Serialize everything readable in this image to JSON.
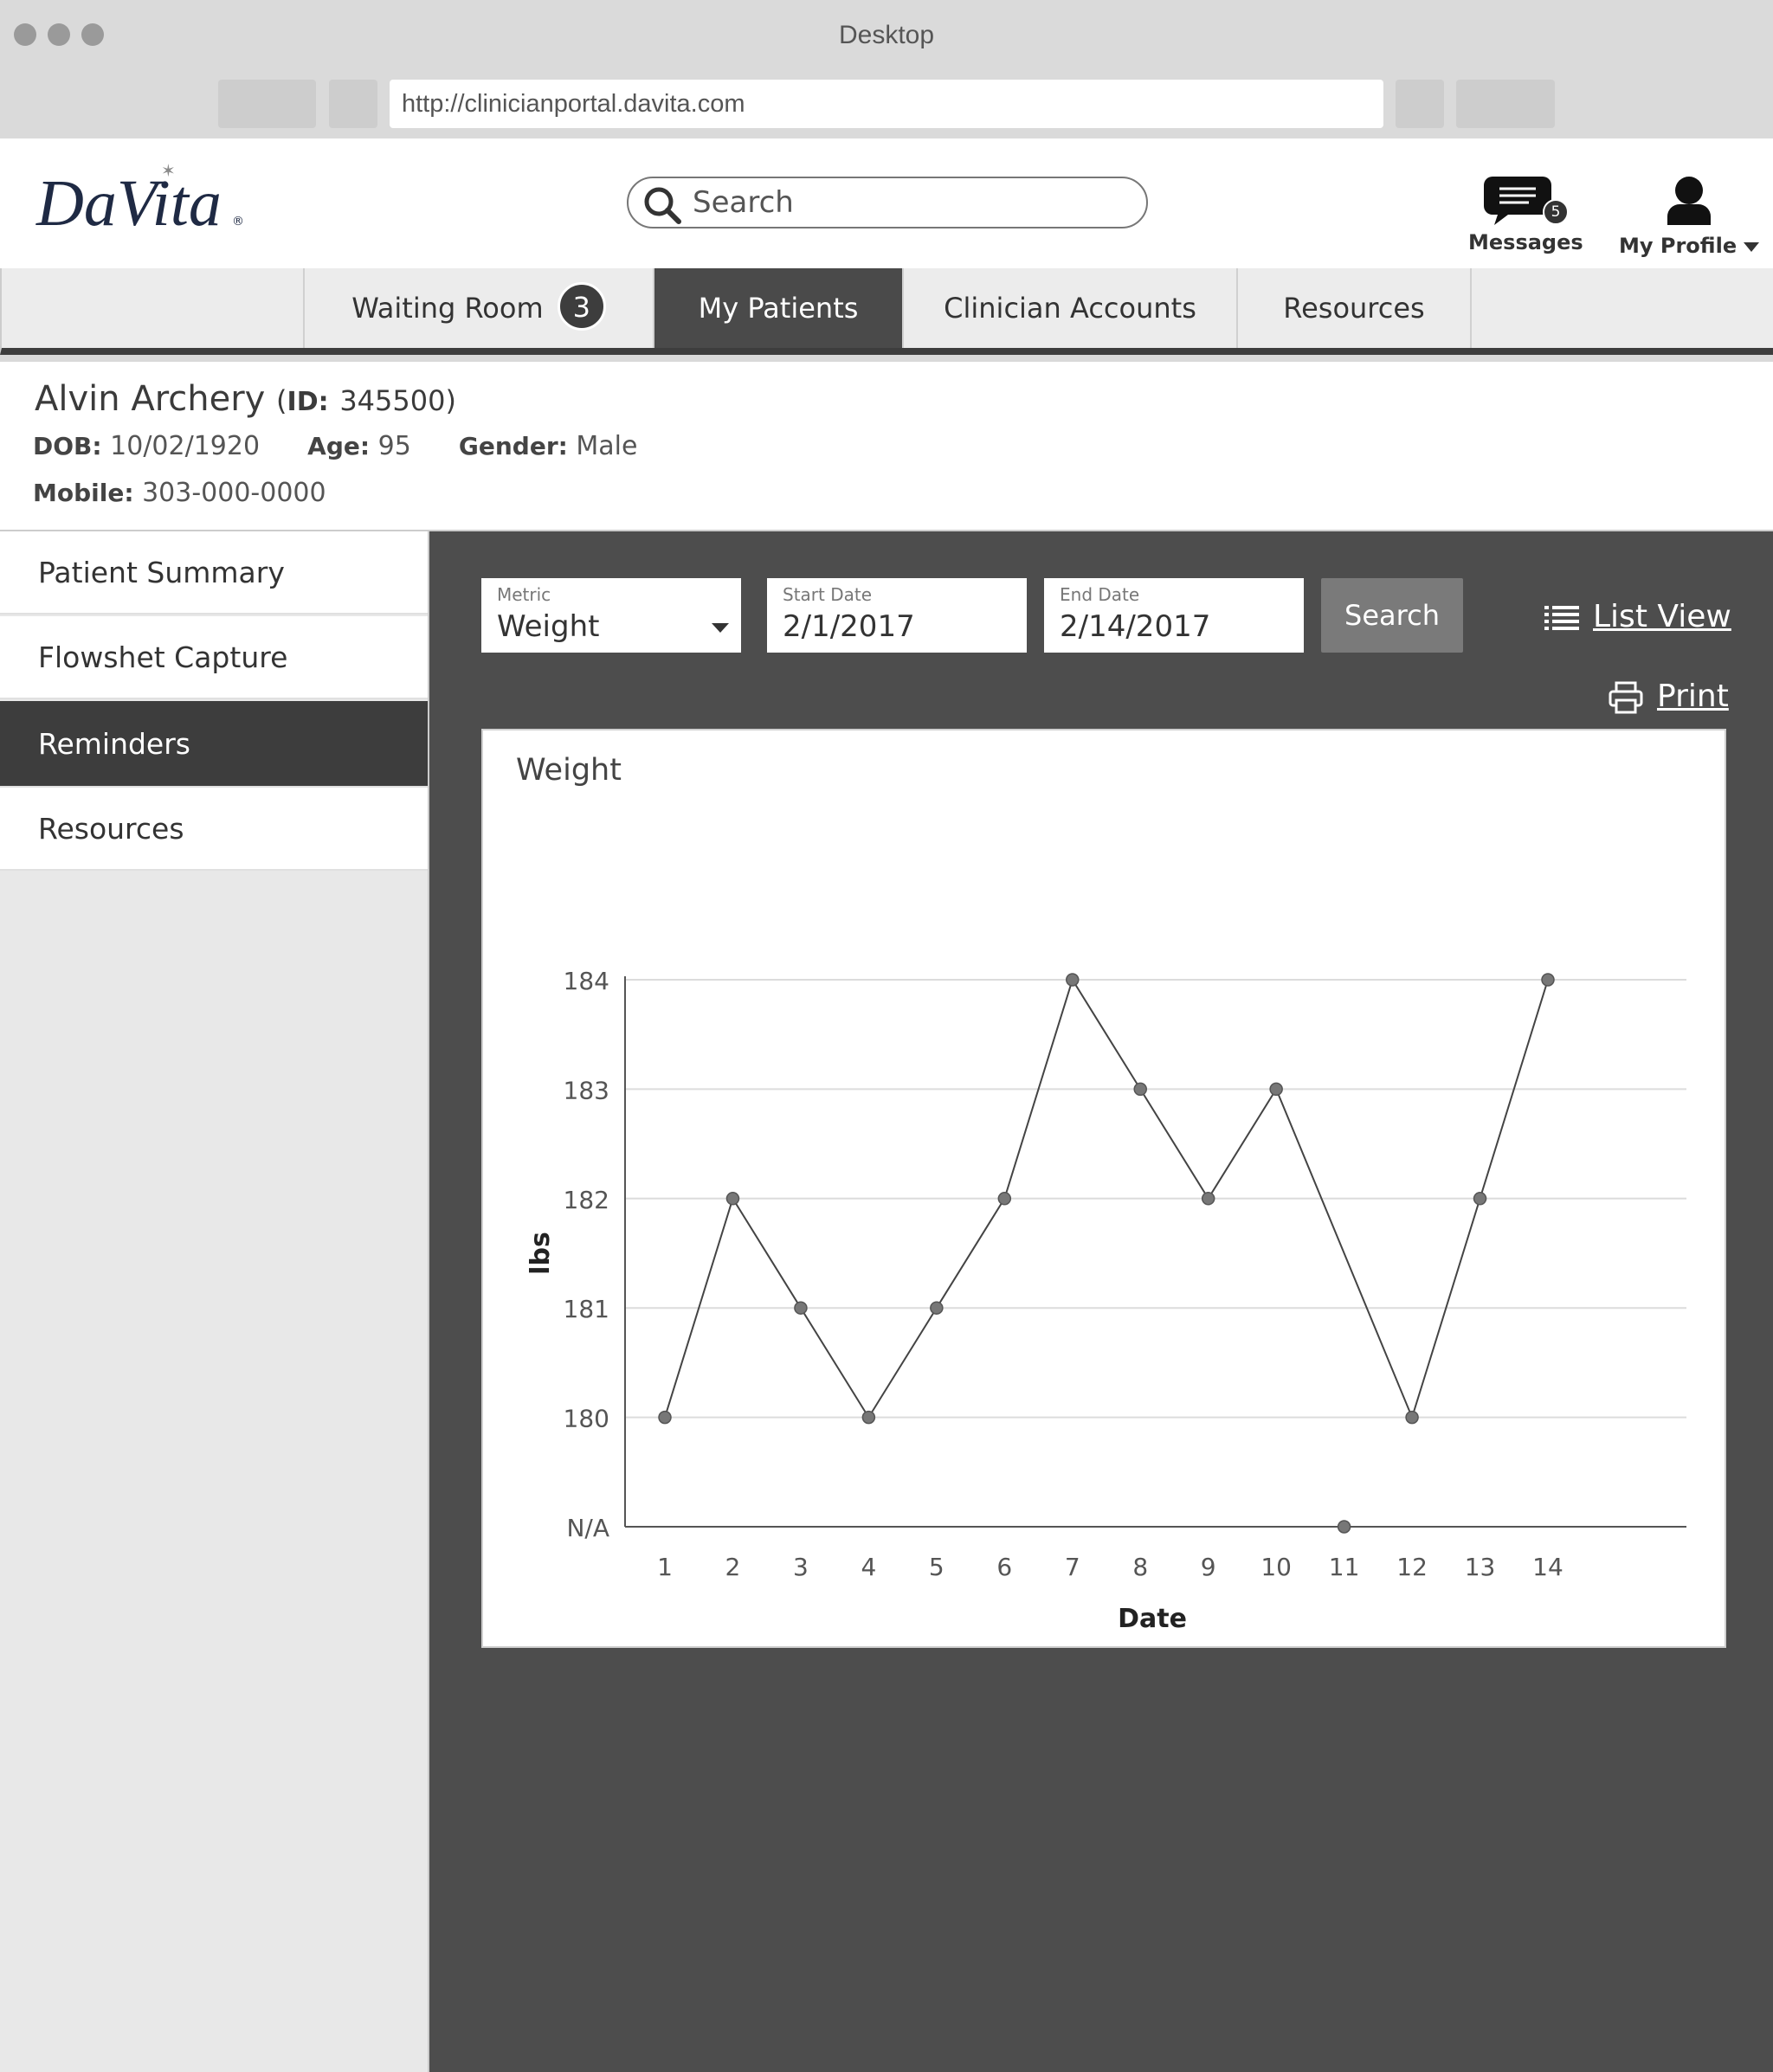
{
  "window": {
    "title": "Desktop",
    "url": "http://clinicianportal.davita.com"
  },
  "brand": {
    "logo_text": "DaVita",
    "primary_color": "#1f2a44"
  },
  "header": {
    "search_placeholder": "Search",
    "messages": {
      "label": "Messages",
      "count": "5",
      "icon": "chat-bubble-icon"
    },
    "profile": {
      "label": "My Profile",
      "icon": "user-icon"
    }
  },
  "nav": {
    "tabs": [
      {
        "label": "Waiting Room",
        "badge": "3"
      },
      {
        "label": "My Patients",
        "active": true
      },
      {
        "label": "Clinician Accounts"
      },
      {
        "label": "Resources"
      }
    ]
  },
  "patient": {
    "name": "Alvin Archery",
    "id_label": "ID:",
    "id_value": "345500",
    "dob_label": "DOB:",
    "dob": "10/02/1920",
    "age_label": "Age:",
    "age": "95",
    "gender_label": "Gender:",
    "gender": "Male",
    "mobile_label": "Mobile:",
    "mobile": "303-000-0000"
  },
  "sidebar": {
    "items": [
      {
        "label": "Patient Summary"
      },
      {
        "label": "Flowshet Capture"
      },
      {
        "label": "Reminders",
        "active": true
      },
      {
        "label": "Resources"
      }
    ]
  },
  "filters": {
    "metric_label": "Metric",
    "metric_value": "Weight",
    "start_label": "Start Date",
    "start_value": "2/1/2017",
    "end_label": "End Date",
    "end_value": "2/14/2017",
    "search_button": "Search",
    "list_view": "List View",
    "print": "Print"
  },
  "chart_data": {
    "type": "line",
    "title": "Weight",
    "xlabel": "Date",
    "ylabel": "lbs",
    "x": [
      1,
      2,
      3,
      4,
      5,
      6,
      7,
      8,
      9,
      10,
      11,
      12,
      13,
      14
    ],
    "y_tick_labels": [
      "N/A",
      "180",
      "181",
      "182",
      "183",
      "184"
    ],
    "ylim": [
      180,
      184
    ],
    "grid": true,
    "series": [
      {
        "values": [
          180,
          182,
          181,
          180,
          181,
          182,
          184,
          183,
          182,
          183,
          null,
          180,
          182,
          184
        ]
      }
    ],
    "missing_label": "N/A"
  }
}
